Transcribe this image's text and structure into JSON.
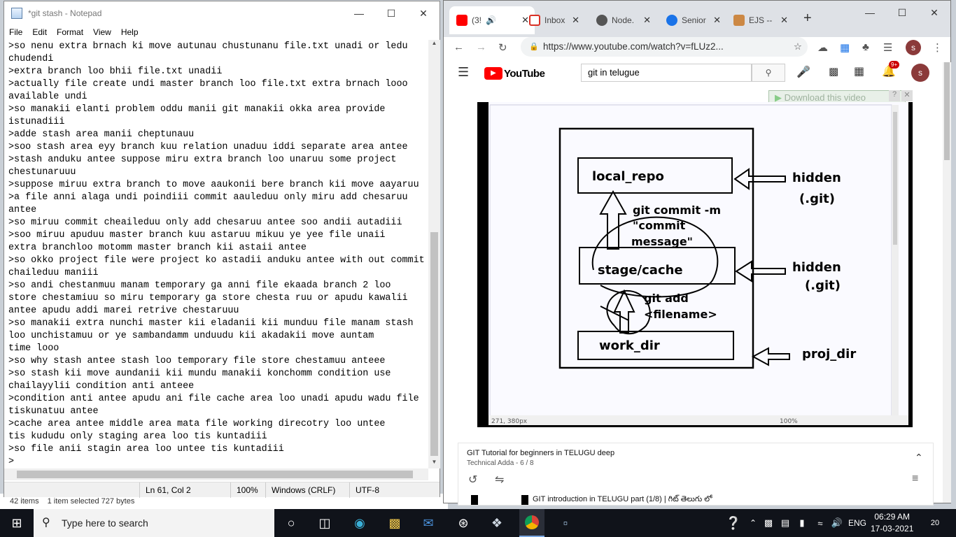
{
  "notepad": {
    "title": "*git stash - Notepad",
    "menu": [
      "File",
      "Edit",
      "Format",
      "View",
      "Help"
    ],
    "lines": [
      ">so nenu extra brnach ki move autunau chustunanu file.txt unadi or ledu",
      "chudendi",
      ">extra branch loo bhii file.txt unadii",
      ">actually file create undi master branch loo file.txt extra brnach looo",
      "available undi",
      ">so manakii elanti problem oddu manii git manakii okka area provide",
      "istunadiii",
      ">adde stash area manii cheptunauu",
      ">soo stash area eyy branch kuu relation unaduu iddi separate area antee",
      ">stash anduku antee suppose miru extra branch loo unaruu some project",
      "chestunaruuu",
      ">suppose miruu extra branch to move aaukonii bere branch kii move aayaruu",
      ">a file anni alaga undi poindiii commit aauleduu only miru add chesaruu",
      "antee",
      ">so miruu commit cheaileduu only add chesaruu antee soo andii autadiii",
      ">soo miruu apuduu master branch kuu astaruu mikuu ye yee file unaii",
      "extra branchloo motomm master branch kii astaii antee",
      ">so okko project file were project ko astadii anduku antee with out commit",
      "chaileduu maniii",
      ">so andi chestanmuu manam temporary ga anni file ekaada branch 2 loo",
      "store chestamiuu so miru temporary ga store chesta ruu or apudu kawalii",
      "antee apudu addi marei retrive chestaruuu",
      ">so manakii extra nunchi master kii eladanii kii munduu file manam stash",
      "loo unchistamuu or ye sambandamm unduudu kii akadakii move auntam",
      "time looo",
      ">so why stash antee stash loo temporary file store chestamuu anteee",
      ">so stash kii move aundanii kii mundu manakii konchomm condition use",
      "chailayylii condition anti anteee",
      ">condition anti antee apudu ani file cache area loo unadi apudu wadu file",
      "tiskunatuu antee",
      ">cache area antee middle area mata file working direcotry loo untee",
      "tis kududu only staging area loo tis kuntadiii",
      ">so file anii stagin area loo untee tis kuntadiii",
      ">"
    ],
    "status": {
      "pos": "Ln 61, Col 2",
      "zoom": "100%",
      "eol": "Windows (CRLF)",
      "enc": "UTF-8"
    }
  },
  "explorer": {
    "items": "42 items",
    "selected": "1 item selected  727 bytes"
  },
  "chrome": {
    "tabs": [
      {
        "label": "(3!",
        "color": "#ff0000"
      },
      {
        "label": "Inbox",
        "color": "#d93025"
      },
      {
        "label": "Node.",
        "color": "#333333"
      },
      {
        "label": "Senior",
        "color": "#1a73e8"
      },
      {
        "label": "EJS --",
        "color": "#a33"
      }
    ],
    "url": "https://www.youtube.com/watch?v=fLUz2...",
    "yt_logo": "YouTube",
    "search": "git in telugue",
    "notif": "9+",
    "avatar": "s",
    "download": "Download this video",
    "diagram": {
      "local_repo": "local_repo",
      "stage": "stage/cache",
      "work": "work_dir",
      "commit": "git commit -m",
      "commit_msg1": "\"commit",
      "commit_msg2": "message\"",
      "add1": "git add",
      "add2": "<filename>",
      "hidden1": "hidden",
      "git1": "(.git)",
      "hidden2": "hidden",
      "git2": "(.git)",
      "proj": "proj_dir"
    },
    "video_status": {
      "coords": "271, 380px",
      "zoom": "100%"
    },
    "playlist": {
      "title": "GIT Tutorial for beginners in TELUGU deep",
      "sub": "Technical Adda - 6 / 8",
      "next": "GIT introduction in TELUGU part (1/8) | గిట్ తెలుగు లో"
    }
  },
  "taskbar": {
    "search": "Type here to search",
    "lang": "ENG",
    "time": "06:29 AM",
    "date": "17-03-2021",
    "notif": "20"
  }
}
